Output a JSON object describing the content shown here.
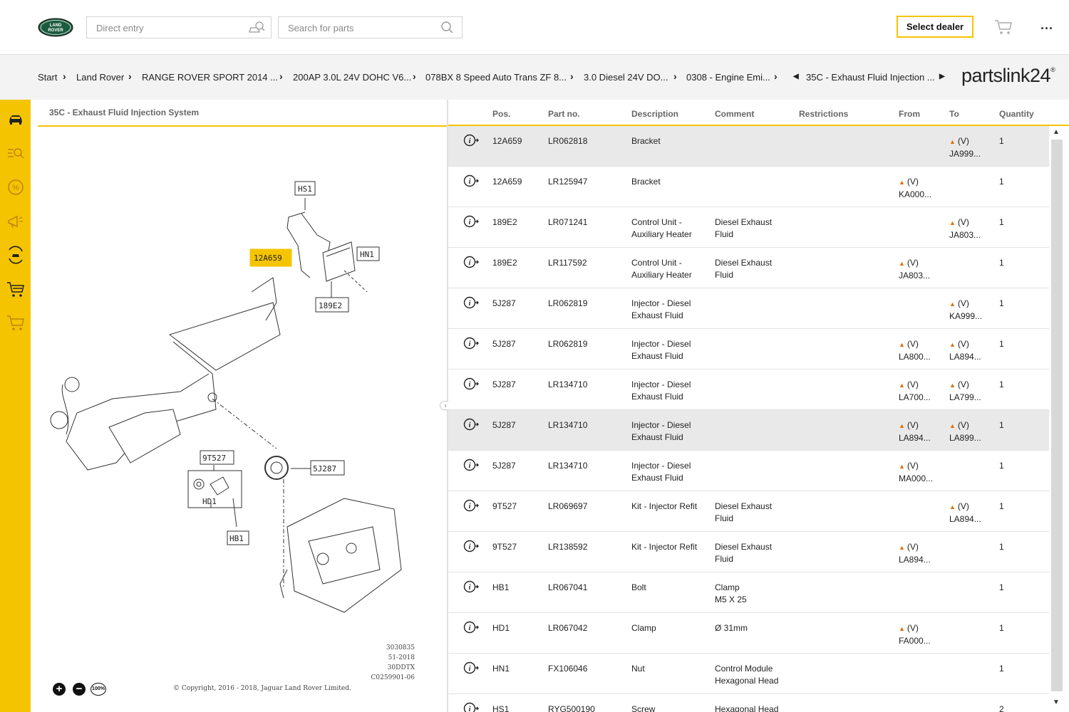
{
  "header": {
    "direct_entry_placeholder": "Direct entry",
    "search_parts_placeholder": "Search for parts",
    "select_dealer_label": "Select dealer",
    "more_label": "..."
  },
  "logo_text": {
    "line1": "LAND",
    "line2": "ROVER"
  },
  "breadcrumb": [
    "Start",
    "Land Rover",
    "RANGE ROVER SPORT 2014 ...",
    "200AP 3.0L 24V DOHC V6...",
    "078BX 8 Speed Auto Trans ZF 8...",
    "3.0 Diesel 24V DO...",
    "0308 - Engine Emi...",
    "35C - Exhaust Fluid Injection ..."
  ],
  "brand": {
    "name": "partslink24",
    "mark": "®"
  },
  "panel": {
    "title": "35C - Exhaust Fluid Injection System",
    "copyright": "© Copyright, 2016 - 2018, Jaguar Land Rover Limited.",
    "meta": [
      "3030835",
      "51-2018",
      "30DDTX",
      "C0259901-06"
    ],
    "zoom_in": "+",
    "zoom_out": "−",
    "zoom_reset": "100%"
  },
  "diagram_labels": {
    "hs1": "HS1",
    "a12a659": "12A659",
    "hn1": "HN1",
    "e189e2": "189E2",
    "t9t527": "9T527",
    "j5j287": "5J287",
    "hd1": "HD1",
    "hb1": "HB1"
  },
  "table": {
    "headers": [
      "Pos.",
      "Part no.",
      "Description",
      "Comment",
      "Restrictions",
      "From",
      "To",
      "Quantity"
    ],
    "rows": [
      {
        "pos": "12A659",
        "part": "LR062818",
        "desc1": "Bracket",
        "desc2": "",
        "com1": "",
        "com2": "",
        "from1": "",
        "from2": "",
        "to1": "(V)",
        "to2": "JA999...",
        "qty": "1"
      },
      {
        "pos": "12A659",
        "part": "LR125947",
        "desc1": "Bracket",
        "desc2": "",
        "com1": "",
        "com2": "",
        "from1": "(V)",
        "from2": "KA000...",
        "to1": "",
        "to2": "",
        "qty": "1"
      },
      {
        "pos": "189E2",
        "part": "LR071241",
        "desc1": "Control Unit -",
        "desc2": "Auxiliary Heater",
        "com1": "Diesel Exhaust",
        "com2": "Fluid",
        "from1": "",
        "from2": "",
        "to1": "(V)",
        "to2": "JA803...",
        "qty": "1"
      },
      {
        "pos": "189E2",
        "part": "LR117592",
        "desc1": "Control Unit -",
        "desc2": "Auxiliary Heater",
        "com1": "Diesel Exhaust",
        "com2": "Fluid",
        "from1": "(V)",
        "from2": "JA803...",
        "to1": "",
        "to2": "",
        "qty": "1"
      },
      {
        "pos": "5J287",
        "part": "LR062819",
        "desc1": "Injector - Diesel",
        "desc2": "Exhaust Fluid",
        "com1": "",
        "com2": "",
        "from1": "",
        "from2": "",
        "to1": "(V)",
        "to2": "KA999...",
        "qty": "1"
      },
      {
        "pos": "5J287",
        "part": "LR062819",
        "desc1": "Injector - Diesel",
        "desc2": "Exhaust Fluid",
        "com1": "",
        "com2": "",
        "from1": "(V)",
        "from2": "LA800...",
        "to1": "(V)",
        "to2": "LA894...",
        "qty": "1"
      },
      {
        "pos": "5J287",
        "part": "LR134710",
        "desc1": "Injector - Diesel",
        "desc2": "Exhaust Fluid",
        "com1": "",
        "com2": "",
        "from1": "(V)",
        "from2": "LA700...",
        "to1": "(V)",
        "to2": "LA799...",
        "qty": "1"
      },
      {
        "pos": "5J287",
        "part": "LR134710",
        "desc1": "Injector - Diesel",
        "desc2": "Exhaust Fluid",
        "com1": "",
        "com2": "",
        "from1": "(V)",
        "from2": "LA894...",
        "to1": "(V)",
        "to2": "LA899...",
        "qty": "1"
      },
      {
        "pos": "5J287",
        "part": "LR134710",
        "desc1": "Injector - Diesel",
        "desc2": "Exhaust Fluid",
        "com1": "",
        "com2": "",
        "from1": "(V)",
        "from2": "MA000...",
        "to1": "",
        "to2": "",
        "qty": "1"
      },
      {
        "pos": "9T527",
        "part": "LR069697",
        "desc1": "Kit -  Injector Refit",
        "desc2": "",
        "com1": "Diesel Exhaust",
        "com2": "Fluid",
        "from1": "",
        "from2": "",
        "to1": "(V)",
        "to2": "LA894...",
        "qty": "1"
      },
      {
        "pos": "9T527",
        "part": "LR138592",
        "desc1": "Kit -  Injector Refit",
        "desc2": "",
        "com1": "Diesel Exhaust",
        "com2": "Fluid",
        "from1": "(V)",
        "from2": "LA894...",
        "to1": "",
        "to2": "",
        "qty": "1"
      },
      {
        "pos": "HB1",
        "part": "LR067041",
        "desc1": "Bolt",
        "desc2": "",
        "com1": "Clamp",
        "com2": "M5 X 25",
        "from1": "",
        "from2": "",
        "to1": "",
        "to2": "",
        "qty": "1"
      },
      {
        "pos": "HD1",
        "part": "LR067042",
        "desc1": "Clamp",
        "desc2": "",
        "com1": "Ø 31mm",
        "com2": "",
        "from1": "(V)",
        "from2": "FA000...",
        "to1": "",
        "to2": "",
        "qty": "1"
      },
      {
        "pos": "HN1",
        "part": "FX106046",
        "desc1": "Nut",
        "desc2": "",
        "com1": "Control Module",
        "com2": "Hexagonal Head",
        "from1": "",
        "from2": "",
        "to1": "",
        "to2": "",
        "qty": "1"
      },
      {
        "pos": "HS1",
        "part": "RYG500190",
        "desc1": "Screw",
        "desc2": "",
        "com1": "Hexagonal Head",
        "com2": "",
        "from1": "",
        "from2": "",
        "to1": "",
        "to2": "",
        "qty": "2"
      }
    ],
    "highlighted_rows": [
      0,
      7
    ]
  },
  "colors": {
    "accent": "#f5c400",
    "warning": "#e07000",
    "highlight_row": "#e9e9e9"
  },
  "icons": [
    "car-icon",
    "search-list-icon",
    "percent-icon",
    "megaphone-icon",
    "vehicle-history-icon",
    "cart-full-icon",
    "cart-icon",
    "info-arrow-icon"
  ]
}
